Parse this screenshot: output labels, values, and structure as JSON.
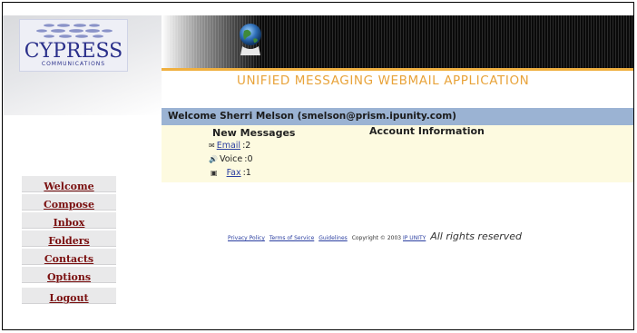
{
  "brand": {
    "logo_text": "CYPRESS",
    "logo_sub": "COMMUNICATIONS"
  },
  "header": {
    "title": "UNIFIED MESSAGING WEBMAIL APPLICATION"
  },
  "welcome": {
    "text": "Welcome  Sherri Melson  (smelson@prism.ipunity.com)"
  },
  "messages": {
    "heading": "New Messages",
    "email_label": "Email",
    "email_count": ":2",
    "voice_label": "Voice",
    "voice_count": ":0",
    "fax_label": "Fax",
    "fax_count": ":1"
  },
  "account": {
    "heading": "Account Information"
  },
  "nav": {
    "items": [
      "Welcome",
      "Compose",
      "Inbox",
      "Folders",
      "Contacts",
      "Options",
      "Logout"
    ]
  },
  "footer": {
    "privacy": "Privacy Policy",
    "terms": "Terms of Service",
    "guidelines": "Guidelines",
    "copyright": "Copyright © 2003",
    "ipunity": "IP UNITY",
    "rights": "All rights reserved"
  },
  "colors": {
    "welcome_bar": "#9bb3d3",
    "panel_bg": "#fdfae0",
    "title_accent": "#e8a33a",
    "nav_text": "#7a1010"
  }
}
